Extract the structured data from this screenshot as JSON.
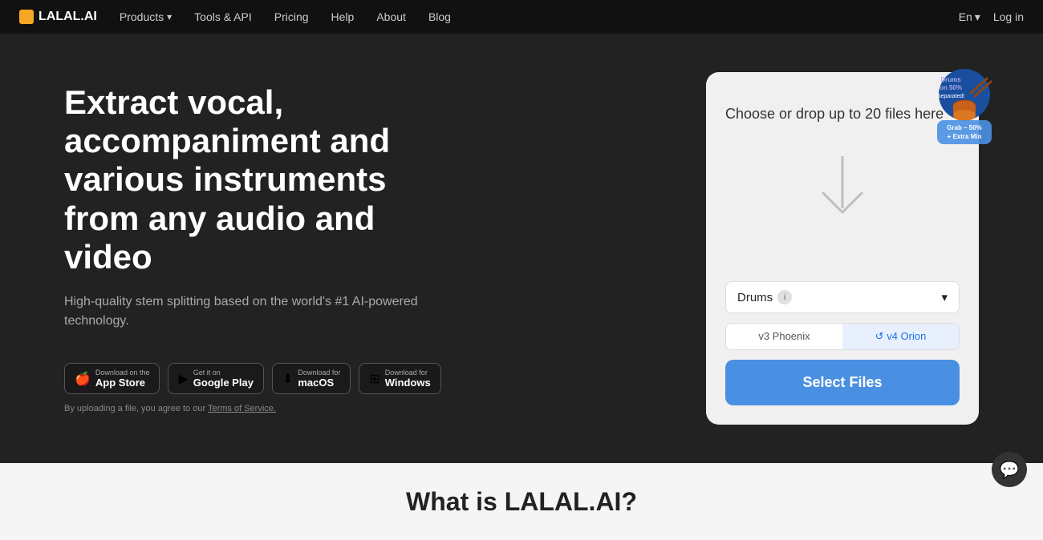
{
  "navbar": {
    "logo_text": "LALAL.AI",
    "links": [
      {
        "label": "Products",
        "has_dropdown": true
      },
      {
        "label": "Tools & API",
        "has_dropdown": false
      },
      {
        "label": "Pricing",
        "has_dropdown": false
      },
      {
        "label": "Help",
        "has_dropdown": false
      },
      {
        "label": "About",
        "has_dropdown": false
      },
      {
        "label": "Blog",
        "has_dropdown": false
      }
    ],
    "lang": "En",
    "login": "Log in"
  },
  "hero": {
    "title": "Extract vocal, accompaniment and various instruments from any audio and video",
    "subtitle": "High-quality stem splitting based on the world's #1 AI-powered technology.",
    "drop_text": "Choose or drop up to 20 files here"
  },
  "promo": {
    "line1": "Drums",
    "line2": "on 50%",
    "line3": "Separated!",
    "line4": "Grab – 50%",
    "line5": "+ Extra Min"
  },
  "model": {
    "name": "Drums",
    "info_icon": "i"
  },
  "versions": [
    {
      "label": "v3 Phoenix",
      "active": false
    },
    {
      "label": "v4 Orion",
      "active": true
    }
  ],
  "select_btn": "Select Files",
  "badges": [
    {
      "icon": "🍎",
      "small": "Download on the",
      "name": "App Store"
    },
    {
      "icon": "▶",
      "small": "Get it on",
      "name": "Google Play"
    },
    {
      "icon": "⬇",
      "small": "Download for",
      "name": "macOS"
    },
    {
      "icon": "⊞",
      "small": "Download for",
      "name": "Windows"
    }
  ],
  "disclaimer": "By uploading a file, you agree to our",
  "disclaimer_link": "Terms of Service.",
  "bottom": {
    "title": "What is LALAL.AI?"
  },
  "chevron": "▾"
}
